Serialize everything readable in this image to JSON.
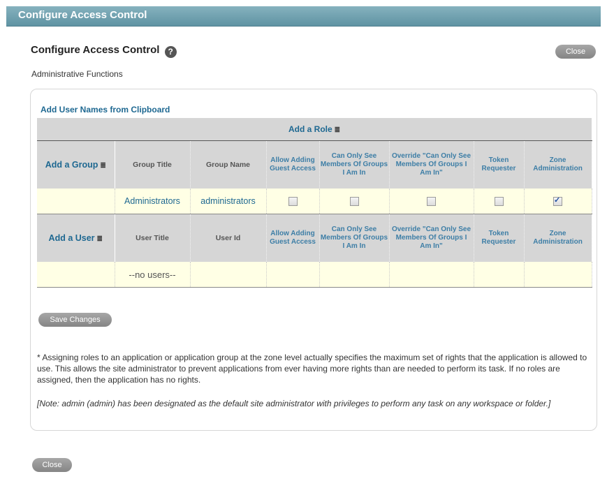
{
  "window": {
    "title": "Configure Access Control"
  },
  "header": {
    "title": "Configure Access Control",
    "help_glyph": "?",
    "close_label": "Close"
  },
  "subtitle": "Administrative Functions",
  "clipboard_link": "Add User Names from Clipboard",
  "roles_header": "Add a Role",
  "filter_glyph": "≣",
  "role_columns": [
    "Allow Adding Guest Access",
    "Can Only See Members Of Groups I Am In",
    "Override \"Can Only See Members Of Groups I Am In\"",
    "Token Requester",
    "Zone Administration"
  ],
  "groups": {
    "add_label": "Add a Group",
    "col_title": "Group Title",
    "col_name": "Group Name",
    "rows": [
      {
        "title": "Administrators",
        "name": "administrators",
        "roles": [
          false,
          false,
          false,
          false,
          true
        ]
      }
    ]
  },
  "users": {
    "add_label": "Add a User",
    "col_title": "User Title",
    "col_id": "User Id",
    "empty_text": "--no users--"
  },
  "save_label": "Save Changes",
  "note_roles": "* Assigning roles to an application or application group at the zone level actually specifies the maximum set of rights that the application is allowed to use. This allows the site administrator to prevent applications from ever having more rights than are needed to perform its task. If no roles are assigned, then the application has no rights.",
  "note_admin": "[Note: admin (admin) has been designated as the default site administrator with privileges to perform any task on any workspace or folder.]",
  "footer": {
    "close_label": "Close"
  },
  "colors": {
    "title_bar": "#6c9eae",
    "link": "#1e6891",
    "header_bg": "#d6d6d6",
    "row_bg": "#ffffe5"
  }
}
